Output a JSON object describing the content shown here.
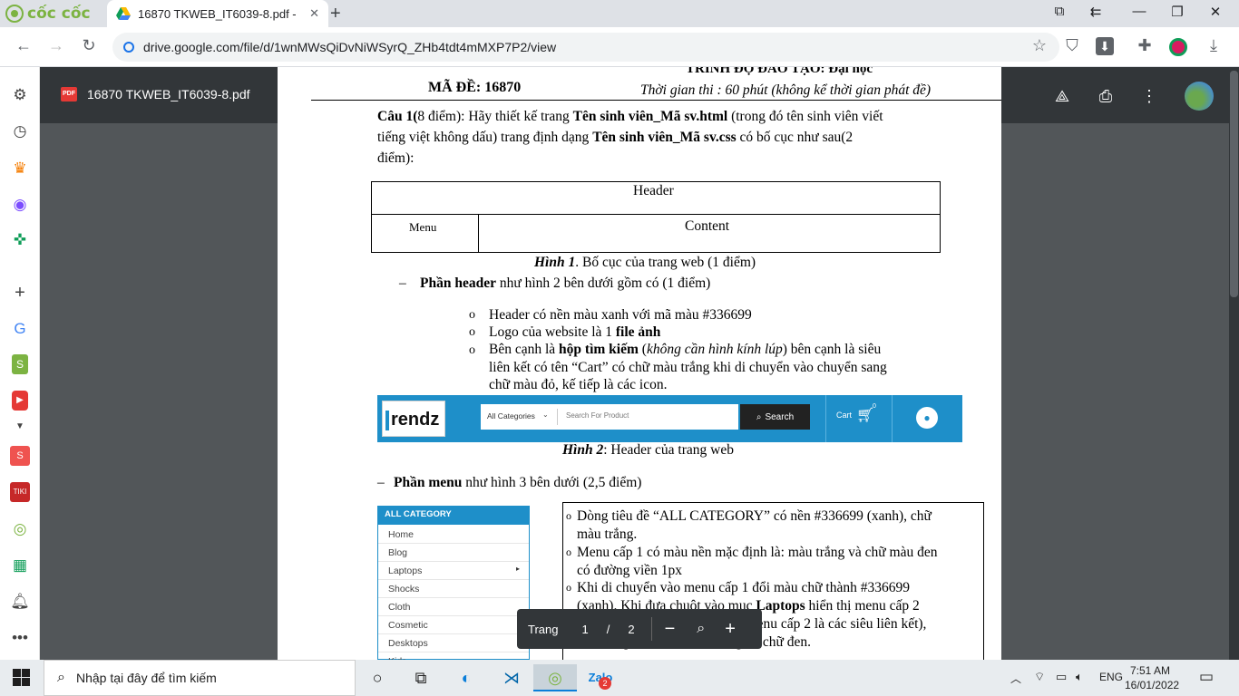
{
  "browser": {
    "brand": "cốc cốc",
    "tab_title": "16870 TKWEB_IT6039-8.pdf -",
    "url": "drive.google.com/file/d/1wnMWsQiDvNiWSyrQ_ZHb4tdt4mMXP7P2/view"
  },
  "viewer": {
    "file_name": "16870 TKWEB_IT6039-8.pdf"
  },
  "doc": {
    "header_right_top": "TRÌNH ĐỘ ĐÀO TẠO: Đại học",
    "ma_de": "MÃ ĐỀ: 16870",
    "thoi_gian": "Thời gian thi : 60  phút (không kể thời gian phát đề)",
    "cau1_line1_a": "Câu 1(",
    "cau1_line1_b": "8 điểm): Hãy thiết kế trang ",
    "cau1_line1_c": "Tên sinh viên_Mã sv.html",
    "cau1_line1_d": " (trong đó tên sinh viên viết",
    "cau1_line2_a": "tiếng việt không dấu)  trang định dạng ",
    "cau1_line2_b": "Tên sinh viên_Mã sv.css",
    "cau1_line2_c": " có bố cục như sau(2",
    "cau1_line3": "điểm):",
    "layout_header": "Header",
    "layout_menu": "Menu",
    "layout_content": "Content",
    "hinh1_label": "Hình 1",
    "hinh1_text": ". Bố cục của trang web (1 điểm)",
    "phan_header_dash": "–",
    "phan_header_bold": "Phần header",
    "phan_header_text": "  như hình 2 bên dưới gồm có (1 điểm)",
    "bullet": "o",
    "b1": "Header có nền màu xanh với mã màu #336699",
    "b2_a": "Logo của website là 1 ",
    "b2_b": "file ảnh",
    "b3_a": "Bên cạnh là ",
    "b3_b": "hộp tìm kiếm",
    "b3_c": " (",
    "b3_d": "không cần hình kính lúp",
    "b3_e": ") bên cạnh là siêu",
    "b3_line2": "liên kết có tên “Cart” có chữ màu trắng khi di chuyển vào chuyển sang",
    "b3_line3": "chữ màu đỏ, kế tiếp là các icon.",
    "hinh2_label": "Hình 2",
    "hinh2_text": ": Header của trang web",
    "phan_menu_dash": "–",
    "phan_menu_bold": "Phần menu",
    "phan_menu_text": " như hình 3 bên dưới (2,5 điểm)",
    "desc1_line1": "Dòng tiêu đề “ALL CATEGORY” có nền #336699 (xanh), chữ",
    "desc1_line2": "màu trắng.",
    "desc2_line1": "Menu cấp 1 có màu nền mặc định là: màu trắng và chữ màu đen",
    "desc2_line2": "có đường viền 1px",
    "desc3_line1_a": "Khi di chuyển vào menu cấp 1 đổi màu chữ thành #336699",
    "desc3_line2_a": "(xanh). Khi đưa chuột vào mục ",
    "desc3_line2_b": "Laptops",
    "desc3_line2_c": " hiển thị menu cấp 2",
    "desc3_line3": "như hình (các thành phần của menu cấp 2 là các siêu liên kết),",
    "desc3_line4": "menu cấp 2 có màu nền trắng và chữ đen."
  },
  "header_image": {
    "logo_text": "rendz",
    "category_select": "All Categories",
    "search_placeholder": "Search For Product",
    "search_button": "Search",
    "cart_label": "Cart",
    "cart_count": "0"
  },
  "menu_image": {
    "title": "ALL CATEGORY",
    "items": [
      "Home",
      "Blog",
      "Laptops",
      "Shocks",
      "Cloth",
      "Cosmetic",
      "Desktops",
      "Kids"
    ]
  },
  "page_nav": {
    "label": "Trang",
    "current": "1",
    "separator": "/",
    "total": "2"
  },
  "taskbar": {
    "search_placeholder": "Nhập tại đây để tìm kiếm",
    "language": "ENG",
    "time": "7:51 AM",
    "date": "16/01/2022",
    "zalo_badge": "2"
  },
  "colors": {
    "header_blue": "#1e8fc9",
    "viewer_bg": "#525659",
    "viewer_bar": "#323639"
  }
}
